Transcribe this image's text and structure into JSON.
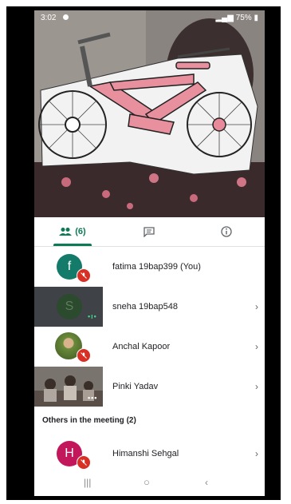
{
  "status": {
    "time": "3:02",
    "battery": "75%"
  },
  "tabs": {
    "people_count": "(6)"
  },
  "participants": [
    {
      "name": "fatima 19bap399 (You)",
      "initial": "f"
    },
    {
      "name": "sneha 19bap548",
      "initial": "S"
    },
    {
      "name": "Anchal Kapoor"
    },
    {
      "name": "Pinki Yadav"
    }
  ],
  "others": {
    "label": "Others in the meeting (2)",
    "people": [
      {
        "name": "Himanshi Sehgal",
        "initial": "H"
      }
    ]
  },
  "colors": {
    "accent": "#0b7a55",
    "muted_mic": "#d93025",
    "avatar_teal": "#147a6a",
    "avatar_pink": "#c2185b"
  },
  "icons": [
    "people-icon",
    "chat-icon",
    "info-icon",
    "mic-off-icon",
    "chevron-right-icon",
    "recents-nav-icon",
    "home-nav-icon",
    "back-nav-icon"
  ]
}
